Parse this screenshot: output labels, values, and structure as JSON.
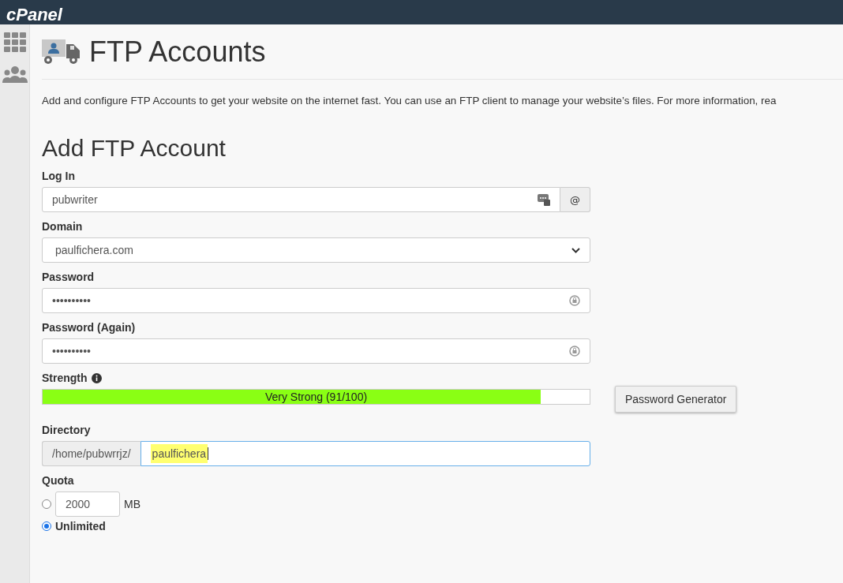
{
  "header": {
    "logo": "cPanel"
  },
  "page": {
    "title": "FTP Accounts",
    "description": "Add and configure FTP Accounts to get your website on the internet fast. You can use an FTP client to manage your website’s files. For more information, rea"
  },
  "form": {
    "title": "Add FTP Account",
    "login": {
      "label": "Log In",
      "value": "pubwriter",
      "addon": "@"
    },
    "domain": {
      "label": "Domain",
      "value": "paulfichera.com"
    },
    "password": {
      "label": "Password",
      "value": "••••••••••"
    },
    "password_again": {
      "label": "Password (Again)",
      "value": "••••••••••"
    },
    "strength": {
      "label": "Strength",
      "reading": "Very Strong (91/100)",
      "level": 0.91,
      "button": "Password Generator"
    },
    "directory": {
      "label": "Directory",
      "prefix": "/home/pubwrrjz/",
      "value": "paulfichera",
      "highlighted": true,
      "focused": true
    },
    "quota": {
      "label": "Quota",
      "options": [
        {
          "kind": "amount",
          "value": "2000",
          "unit": "MB",
          "selected": false
        },
        {
          "kind": "label",
          "label": "Unlimited",
          "selected": true
        }
      ]
    }
  }
}
